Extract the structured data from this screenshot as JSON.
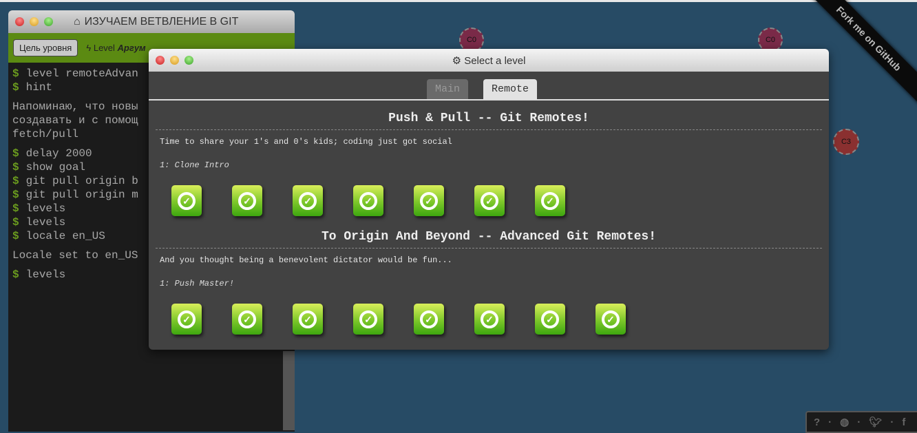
{
  "graph": {
    "nodes": [
      "C0",
      "C0",
      "C3"
    ]
  },
  "ribbon": "Fork me on GitHub",
  "terminal": {
    "title": "ИЗУЧАЕМ ВЕТВЛЕНИЕ В GIT",
    "goal_button": "Цель уровня",
    "level_prefix": "Level",
    "level_name": "Аргум",
    "commands_a": [
      "level remoteAdvan",
      "hint"
    ],
    "hint_text": [
      "Напоминаю, что новы",
      "создавать и с помощ",
      "fetch/pull"
    ],
    "commands_b": [
      "delay 2000",
      "show goal",
      "git pull origin b",
      "git pull origin m",
      "levels",
      "levels",
      "locale en_US"
    ],
    "locale_msg": "Locale set to en_US",
    "commands_c": [
      "levels"
    ],
    "prompt": "$"
  },
  "modal": {
    "title": "Select a level",
    "tabs": [
      {
        "label": "Main",
        "active": false
      },
      {
        "label": "Remote",
        "active": true
      }
    ],
    "sections": [
      {
        "title": "Push & Pull -- Git Remotes!",
        "desc": "Time to share your 1's and 0's kids; coding just got social",
        "selected": "1: Clone Intro",
        "levels": 7,
        "completed": 7
      },
      {
        "title": "To Origin And Beyond -- Advanced Git Remotes!",
        "desc": "And you thought being a benevolent dictator would be fun...",
        "selected": "1: Push Master!",
        "levels": 8,
        "completed": 8
      }
    ]
  },
  "footer": {
    "icons": [
      "help-icon",
      "globe-icon",
      "twitter-icon",
      "facebook-icon"
    ],
    "separator": "·",
    "facebook": "f"
  },
  "colors": {
    "background": "#274b65",
    "toolbar": "#5b8a12",
    "node": "#7a2a48",
    "level_done": "#7cc72a"
  }
}
